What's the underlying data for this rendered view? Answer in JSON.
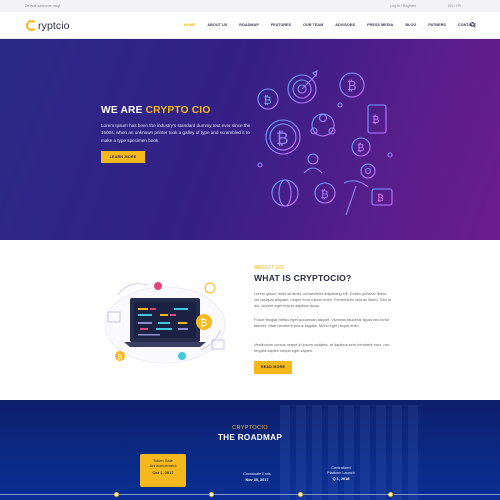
{
  "topbar": {
    "welcome": "Default welcome msg!",
    "account": "Log in / Register",
    "language": "EN / FR"
  },
  "nav": {
    "logo_text": "ryptcio",
    "items": [
      "HOME",
      "ABOUT US",
      "ROADMAP",
      "FEATURES",
      "OUR TEAM",
      "ADVISORS",
      "PRESS MEDIA",
      "BLOG",
      "PATNERS",
      "CONTACT"
    ],
    "active_index": 0
  },
  "hero": {
    "title_prefix": "WE ARE ",
    "title_accent": "CRYPTO CIO",
    "text": "Lorem Ipsum has been the industry's standard dummy text ever since the 1500s, when an unknown printer took a galley of type and scrambled it to make a type specimen book.",
    "button": "LEARN MORE"
  },
  "about": {
    "subtitle": "ABOUT US",
    "title": "WHAT IS CRYPTOCIO?",
    "p1": "Lorem ipsum dolor sit amet, consectetur adipiscing elit. Donec pulvinar libero vel volutpat aliquam, neque eros rutrum enim. Fermentum velit ac libero. Sed ut dui, laoreet eget erat et dapibus lacus.",
    "p2": "Fusce feugiat metus eget accumsan aliquet. Vivamus faucibus ligula nec tortor laoreet, vitae hendrerit purus sagittis. Morbi eget neque enim.",
    "p3": "Vestibulum cursus neque id ipsum sodales, at dapibus sem hendrerit eros, nec fringilla sapien neque eget sapien.",
    "button": "READ MORE"
  },
  "roadmap": {
    "subtitle": "CRYPTOCIO",
    "title": "THE ROADMAP",
    "highlight": {
      "title_line1": "Token Sale",
      "title_line2": "Announcement",
      "date": "Oct 1, 2017"
    },
    "milestones": [
      {
        "title": "Crowdsale Ends",
        "date": "Nov 30, 2017"
      },
      {
        "title_line1": "Centralized",
        "title_line2": "Platform Launch",
        "date": "Q 1, 2018"
      }
    ]
  },
  "colors": {
    "accent": "#f5b81d",
    "hero_start": "#2a2a86",
    "hero_end": "#6b1c8e",
    "roadmap_bg": "#0a2a86"
  }
}
